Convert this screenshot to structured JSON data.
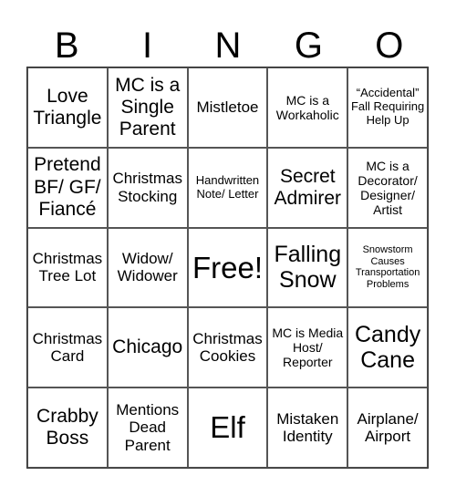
{
  "header": [
    "B",
    "I",
    "N",
    "G",
    "O"
  ],
  "board": {
    "rows": [
      [
        {
          "text": "Love Triangle",
          "size": "l"
        },
        {
          "text": "MC is a Single Parent",
          "size": "l"
        },
        {
          "text": "Mistletoe",
          "size": "m"
        },
        {
          "text": "MC is a Workaholic",
          "size": "sm"
        },
        {
          "text": "“Accidental” Fall Requiring Help Up",
          "size": "s"
        }
      ],
      [
        {
          "text": "Pretend BF/ GF/ Fiancé",
          "size": "l"
        },
        {
          "text": "Christmas Stocking",
          "size": "m"
        },
        {
          "text": "Handwritten Note/ Letter",
          "size": "s"
        },
        {
          "text": "Secret Admirer",
          "size": "l"
        },
        {
          "text": "MC is a Decorator/ Designer/ Artist",
          "size": "sm"
        }
      ],
      [
        {
          "text": "Christmas Tree Lot",
          "size": "m"
        },
        {
          "text": "Widow/ Widower",
          "size": "m"
        },
        {
          "text": "Free!",
          "size": "xxl"
        },
        {
          "text": "Falling Snow",
          "size": "xl"
        },
        {
          "text": "Snowstorm Causes Transportation Problems",
          "size": "xs"
        }
      ],
      [
        {
          "text": "Christmas Card",
          "size": "m"
        },
        {
          "text": "Chicago",
          "size": "l"
        },
        {
          "text": "Christmas Cookies",
          "size": "m"
        },
        {
          "text": "MC is Media Host/ Reporter",
          "size": "sm"
        },
        {
          "text": "Candy Cane",
          "size": "xl"
        }
      ],
      [
        {
          "text": "Crabby Boss",
          "size": "l"
        },
        {
          "text": "Mentions Dead Parent",
          "size": "m"
        },
        {
          "text": "Elf",
          "size": "xxl"
        },
        {
          "text": "Mistaken Identity",
          "size": "m"
        },
        {
          "text": "Airplane/ Airport",
          "size": "m"
        }
      ]
    ]
  }
}
